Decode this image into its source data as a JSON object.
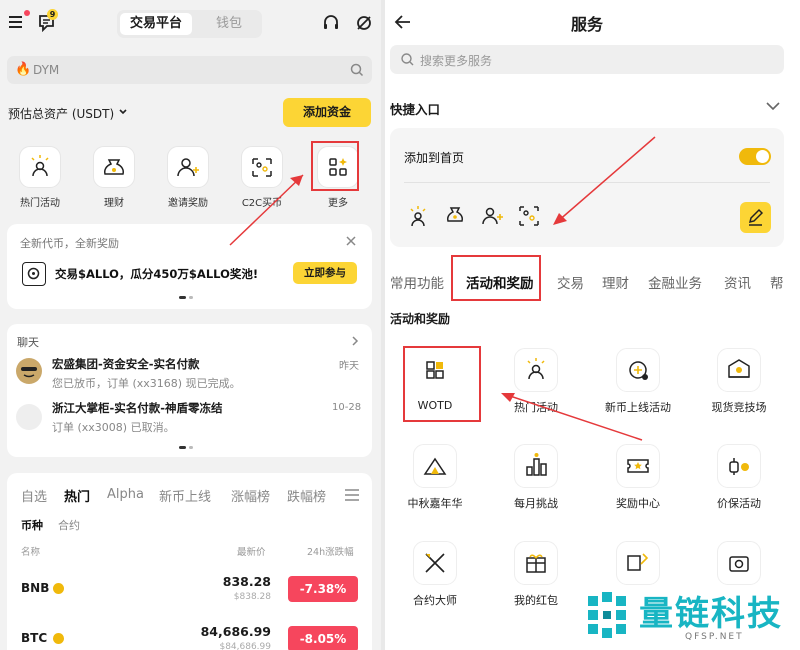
{
  "left": {
    "header": {
      "tab_active": "交易平台",
      "tab_inactive": "钱包",
      "message_badge": "9"
    },
    "search": {
      "placeholder": "DYM"
    },
    "assets": {
      "label": "预估总资产 (USDT)",
      "add_funds_button": "添加资金"
    },
    "quick_actions": [
      {
        "label": "热门活动",
        "icon": "sun-person-icon"
      },
      {
        "label": "理财",
        "icon": "moneybag-icon"
      },
      {
        "label": "邀请奖励",
        "icon": "user-plus-icon"
      },
      {
        "label": "C2C买币",
        "icon": "c2c-users-icon"
      },
      {
        "label": "更多",
        "icon": "grid-more-icon"
      }
    ],
    "promo": {
      "header": "全新代币，全新奖励",
      "text": "交易$ALLO，瓜分450万$ALLO奖池!",
      "button": "立即参与"
    },
    "chat": {
      "title": "聊天",
      "items": [
        {
          "name": "宏盛集团-资金安全-实名付款",
          "time": "昨天",
          "message": "您已放币，订单 (xx3168) 现已完成。"
        },
        {
          "name": "浙江大掌柜-实名付款-神盾零冻结",
          "time": "10-28",
          "message": "订单 (xx3008) 已取消。"
        }
      ]
    },
    "market": {
      "tabs": [
        "自选",
        "热门",
        "Alpha",
        "新币上线",
        "涨幅榜",
        "跌幅榜"
      ],
      "active_tab": "热门",
      "subtabs": [
        "币种",
        "合约"
      ],
      "col_name": "名称",
      "col_price": "最新价",
      "col_change": "24h涨跌幅",
      "rows": [
        {
          "symbol": "BNB",
          "price": "838.28",
          "price_usd": "$838.28",
          "change": "-7.38%"
        },
        {
          "symbol": "BTC",
          "price": "84,686.99",
          "price_usd": "$84,686.99",
          "change": "-8.05%"
        }
      ]
    }
  },
  "right": {
    "title": "服务",
    "search_placeholder": "搜索更多服务",
    "shortcut_title": "快捷入口",
    "add_home_label": "添加到首页",
    "toggle_on": true,
    "category_tabs": [
      "常用功能",
      "活动和奖励",
      "交易",
      "理财",
      "金融业务",
      "资讯",
      "帮"
    ],
    "active_category": "活动和奖励",
    "section_title": "活动和奖励",
    "grid_items": [
      {
        "label": "WOTD",
        "icon": "wotd-grid-icon"
      },
      {
        "label": "热门活动",
        "icon": "sun-person-icon"
      },
      {
        "label": "新币上线活动",
        "icon": "new-coin-icon"
      },
      {
        "label": "现货竞技场",
        "icon": "arena-icon"
      },
      {
        "label": "中秋嘉年华",
        "icon": "tent-icon"
      },
      {
        "label": "每月挑战",
        "icon": "bar-chart-icon"
      },
      {
        "label": "奖励中心",
        "icon": "ticket-star-icon"
      },
      {
        "label": "价保活动",
        "icon": "price-protect-icon"
      },
      {
        "label": "合约大师",
        "icon": "crossed-swords-icon"
      },
      {
        "label": "我的红包",
        "icon": "gift-icon"
      },
      {
        "label": "",
        "icon": "book-pen-icon"
      },
      {
        "label": "",
        "icon": "camera-box-icon"
      }
    ]
  },
  "watermark": {
    "text": "量链科技",
    "domain": "QFSP.NET"
  },
  "colors": {
    "accent_yellow": "#fcd535",
    "red": "#f6465d",
    "annotation_red": "#e5393b"
  }
}
